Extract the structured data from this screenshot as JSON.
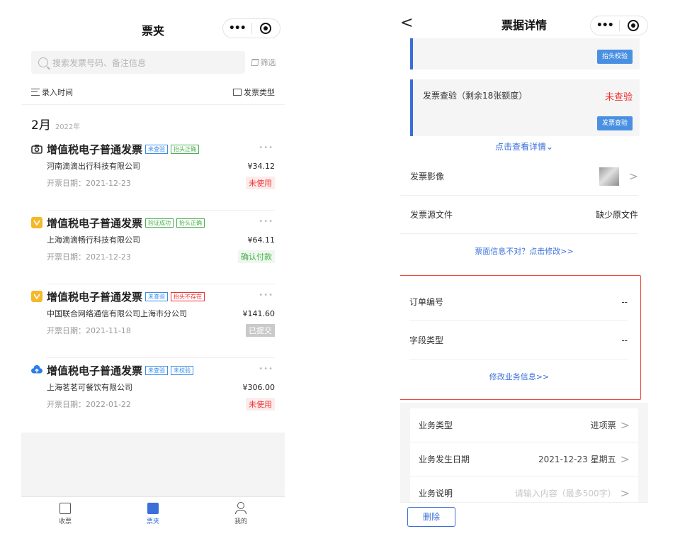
{
  "left": {
    "nav_title": "票夹",
    "search_placeholder": "搜索发票号码、备注信息",
    "filter_label": "筛选",
    "sort_time_label": "录入时间",
    "sort_type_label": "发票类型",
    "month": "2月",
    "year": "2022年",
    "invoices": [
      {
        "title": "增值税电子普通发票",
        "icon": "camera-icon",
        "icon_color": "#333333",
        "tags": [
          {
            "text": "未查验",
            "color": "blue"
          },
          {
            "text": "抬头正确",
            "color": "green"
          }
        ],
        "company": "河南滴滴出行科技有限公司",
        "amount": "¥34.12",
        "date": "开票日期：2021-12-23",
        "status": "未使用",
        "status_color": "red"
      },
      {
        "title": "增值税电子普通发票",
        "icon": "wechat-icon",
        "icon_color": "#f5b829",
        "tags": [
          {
            "text": "验证成功",
            "color": "green"
          },
          {
            "text": "抬头正确",
            "color": "green"
          }
        ],
        "company": "上海滴滴畅行科技有限公司",
        "amount": "¥64.11",
        "date": "开票日期：2021-12-23",
        "status": "确认付款",
        "status_color": "green"
      },
      {
        "title": "增值税电子普通发票",
        "icon": "wechat-icon",
        "icon_color": "#f5b829",
        "tags": [
          {
            "text": "未查验",
            "color": "blue"
          },
          {
            "text": "抬头不存在",
            "color": "red"
          }
        ],
        "company": "中国联合网络通信有限公司上海市分公司",
        "amount": "¥141.60",
        "date": "开票日期：2021-11-18",
        "status": "已提交",
        "status_color": "gray"
      },
      {
        "title": "增值税电子普通发票",
        "icon": "cloud-upload-icon",
        "icon_color": "#2b7de9",
        "tags": [
          {
            "text": "未查验",
            "color": "blue"
          },
          {
            "text": "未校验",
            "color": "blue"
          }
        ],
        "company": "上海茗茗可餐饮有限公司",
        "amount": "¥306.00",
        "date": "开票日期：2022-01-22",
        "status": "未使用",
        "status_color": "red"
      }
    ],
    "more_label": "•••",
    "tabbar": [
      {
        "label": "收票",
        "icon": "receipt-icon"
      },
      {
        "label": "票夹",
        "icon": "folder-icon"
      },
      {
        "label": "我的",
        "icon": "user-icon"
      }
    ]
  },
  "right": {
    "back_label": "<",
    "nav_title": "票据详情",
    "header_verify_btn": "抬头校验",
    "verify_title": "发票查验（剩余18张额度）",
    "verify_status": "未查验",
    "verify_btn": "发票查验",
    "detail_link": "点击查看详情⌄",
    "image_label": "发票影像",
    "source_label": "发票源文件",
    "source_value": "缺少原文件",
    "edit_link": "票面信息不对？点击修改>>",
    "order_label": "订单编号",
    "order_value": "--",
    "field_label": "字段类型",
    "field_value": "--",
    "biz_edit_link": "修改业务信息>>",
    "biz_type_label": "业务类型",
    "biz_type_value": "进项票",
    "biz_date_label": "业务发生日期",
    "biz_date_value": "2021-12-23  星期五",
    "biz_desc_label": "业务说明",
    "biz_desc_placeholder": "请输入内容（最多500字）",
    "delete_btn": "删除",
    "chevron": ">"
  },
  "colors": {
    "accent": "#3a6fd8",
    "danger": "#e33333",
    "highlight_border": "#e74c3c"
  }
}
